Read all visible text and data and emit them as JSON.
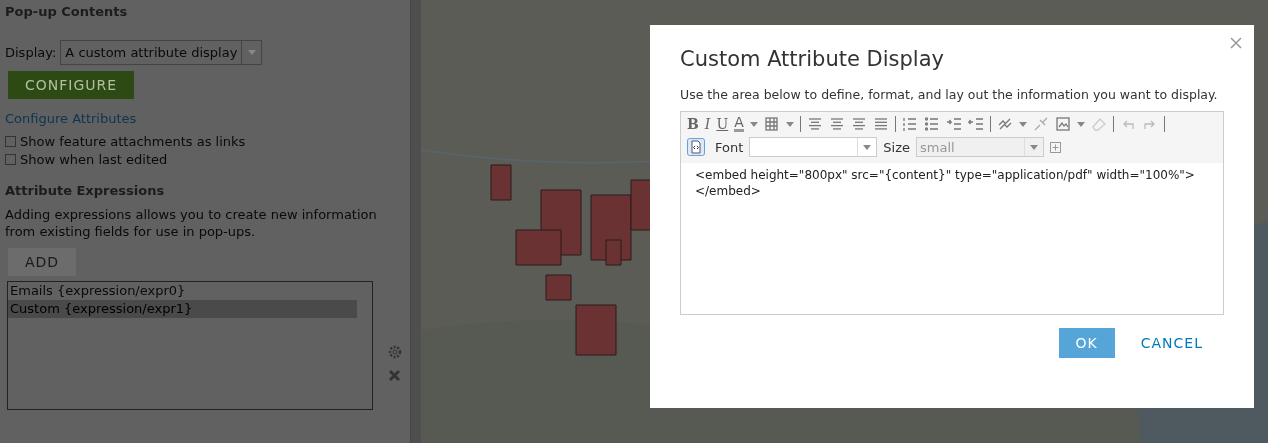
{
  "panel": {
    "title": "Pop-up Contents",
    "display_label": "Display:",
    "display_value": "A custom attribute display",
    "configure_button": "CONFIGURE",
    "link": "Configure Attributes",
    "options": [
      {
        "label": "Show feature attachments as links",
        "checked": false
      },
      {
        "label": "Show when last edited",
        "checked": false
      }
    ],
    "expressions_title": "Attribute Expressions",
    "expressions_text": "Adding expressions allows you to create new information from existing fields for use in pop-ups.",
    "add_button": "ADD",
    "expressions": [
      {
        "label": "Emails {expression/expr0}",
        "selected": false
      },
      {
        "label": "Custom {expression/expr1}",
        "selected": true
      }
    ]
  },
  "dialog": {
    "title": "Custom Attribute Display",
    "description": "Use the area below to define, format, and lay out the information you want to display.",
    "format_tools": [
      {
        "kind": "bold",
        "label": "B"
      },
      {
        "kind": "italic",
        "label": "I"
      },
      {
        "kind": "underline",
        "label": "U"
      },
      {
        "kind": "color",
        "label": "A"
      }
    ],
    "font_label": "Font",
    "size_label": "Size",
    "size_value": "small",
    "content_lines": [
      "<embed height=\"800px\" src=\"{content}\" type=\"application/pdf\" width=\"100%\">",
      "</embed>"
    ],
    "ok_button": "OK",
    "cancel_button": "CANCEL"
  }
}
